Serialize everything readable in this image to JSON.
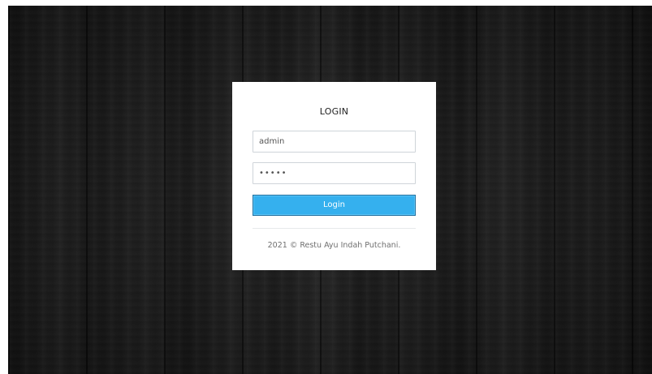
{
  "login": {
    "title": "LOGIN",
    "username_value": "admin",
    "password_value": "•••••",
    "button_label": "Login",
    "footer": "2021 © Restu Ayu Indah Putchani."
  },
  "colors": {
    "button": "#35b0ee",
    "background": "#1b1b1b",
    "card": "#ffffff"
  }
}
